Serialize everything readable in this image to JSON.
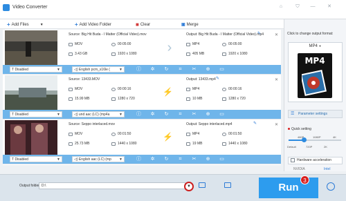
{
  "app": {
    "title": "Video Converter"
  },
  "toolbar": {
    "add_files": "Add Files",
    "add_folder": "Add Video Folder",
    "clear": "Clear",
    "merge": "Merge"
  },
  "files": [
    {
      "source": "Source: Big Hit Buda - I Matter (Official Video).mov",
      "target": "Output: Big Hit Buda - I Matter (Official Video).mp4",
      "src_format": "MOV",
      "src_duration": "00:05:00",
      "src_size": "3.43 GB",
      "src_res": "1920 x 1080",
      "dst_format": "MP4",
      "dst_duration": "00:05:00",
      "dst_size": "405 MB",
      "dst_res": "1920 x 1080",
      "subtitle": "Disabled",
      "audio": "English pcm_s16le (",
      "accel": false
    },
    {
      "source": "Source: 13433.MOV",
      "target": "Output: 13433.mp4",
      "src_format": "MOV",
      "src_duration": "00:00:16",
      "src_size": "15.99 MB",
      "src_res": "1280 x 720",
      "dst_format": "MP4",
      "dst_duration": "00:00:16",
      "dst_size": "10 MB",
      "dst_res": "1280 x 720",
      "subtitle": "Disabled",
      "audio": "und aac (LC) (mp4a",
      "accel": true
    },
    {
      "source": "Source: Seppo interlaced.mov",
      "target": "Output: Seppo interlaced.mp4",
      "src_format": "MOV",
      "src_duration": "00:01:50",
      "src_size": "25.73 MB",
      "src_res": "1440 x 1080",
      "dst_format": "MP4",
      "dst_duration": "00:01:50",
      "dst_size": "19 MB",
      "dst_res": "1440 x 1080",
      "subtitle": "Disabled",
      "audio": "English aac (LC) (mp",
      "accel": true
    }
  ],
  "right_panel": {
    "hint": "Click to change output format:",
    "format": "MP4",
    "format_card": "MP4",
    "parameter_settings": "Parameter settings",
    "quick_setting": "Quick setting",
    "quality_top": [
      "480P",
      "1080P",
      "4K"
    ],
    "quality_bottom": [
      "Default",
      "720P",
      "2K"
    ],
    "quality_level": 0.25,
    "hw_accel": "Hardware acceleration",
    "nvidia": "NVIDIA",
    "intel": "Intel"
  },
  "bottom": {
    "output_label": "Output folder:",
    "output_value": "D:\\",
    "run": "Run",
    "step_badge": "3"
  },
  "colors": {
    "accent": "#2d9cee",
    "bar": "#6fb5ea",
    "highlight": "#cc1e1e",
    "bolt": "#ff8a00"
  }
}
